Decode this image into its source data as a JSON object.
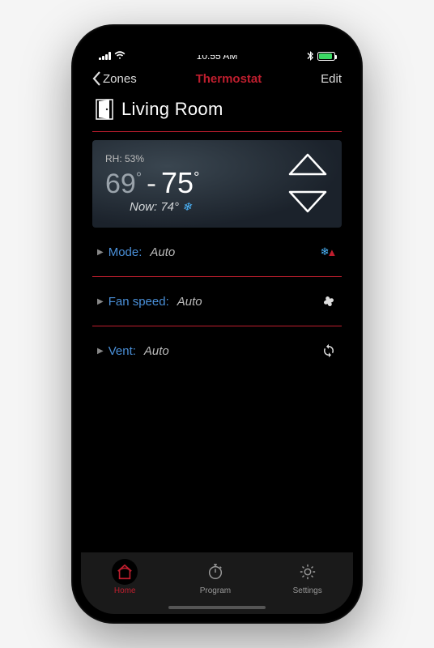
{
  "status": {
    "time": "10:55 AM"
  },
  "nav": {
    "back_label": "Zones",
    "title": "Thermostat",
    "edit_label": "Edit"
  },
  "room": {
    "name": "Living Room",
    "rh_label": "RH: 53%",
    "temp_low": "69",
    "temp_high": "75",
    "now_label": "Now: 74°"
  },
  "settings": {
    "mode": {
      "label": "Mode:",
      "value": "Auto"
    },
    "fan": {
      "label": "Fan speed:",
      "value": "Auto"
    },
    "vent": {
      "label": "Vent:",
      "value": "Auto"
    }
  },
  "tabs": {
    "home": "Home",
    "program": "Program",
    "settings": "Settings"
  },
  "colors": {
    "accent": "#bf1e2e",
    "link": "#4a90d9"
  }
}
